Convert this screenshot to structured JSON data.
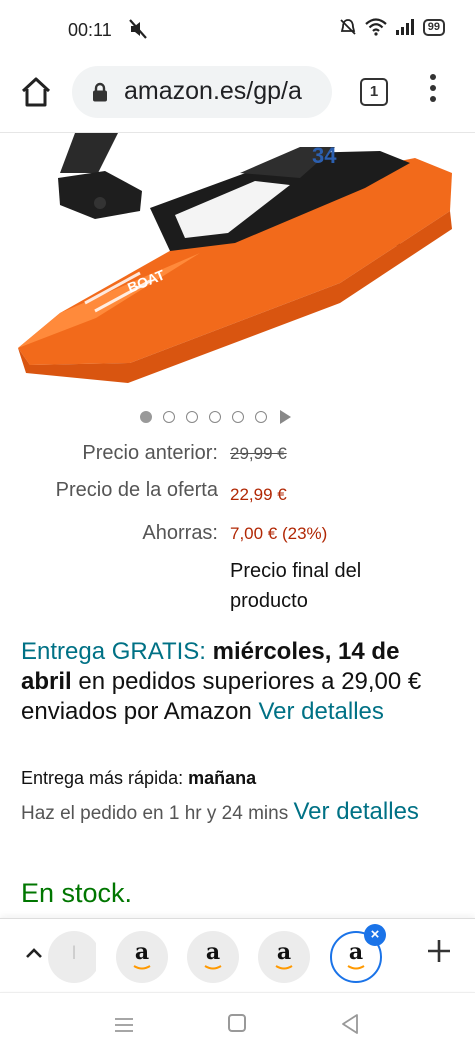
{
  "status_bar": {
    "time": "00:11",
    "battery": "99"
  },
  "browser": {
    "url": "amazon.es/gp/a",
    "tab_count": "1"
  },
  "product_image": {
    "brand_text": "BOAT",
    "number_text": "34",
    "colors": {
      "hull": "#f26a1b",
      "deck": "#1c1c1c"
    }
  },
  "gallery": {
    "dots_total": 6,
    "active_index": 0
  },
  "pricing": {
    "previous_label": "Precio anterior:",
    "previous_value": "29,99 €",
    "deal_label": "Precio de la oferta",
    "deal_value": "22,99 €",
    "savings_label": "Ahorras:",
    "savings_value": "7,00 € (23%)",
    "final_note": "Precio final del producto"
  },
  "delivery": {
    "free_label": "Entrega GRATIS:",
    "date": "miércoles, 14 de abril",
    "text": " en pedidos superiores a 29,00 € enviados por Amazon ",
    "link": "Ver detalles"
  },
  "fast_delivery": {
    "label": "Entrega más rápida: ",
    "day": "mañana",
    "order_text": "Haz el pedido en 1 hr y 24 mins ",
    "link": "Ver detalles"
  },
  "stock": {
    "text": "En stock."
  },
  "tab_strip": {
    "partial_tab_letter": "l",
    "tabs": [
      {
        "letter": "a"
      },
      {
        "letter": "a"
      },
      {
        "letter": "a"
      },
      {
        "letter": "a",
        "selected": true
      }
    ],
    "close_symbol": "×"
  },
  "colors": {
    "link": "#007185",
    "price": "#B12704",
    "stock": "#007600",
    "accent": "#1a73e8"
  }
}
